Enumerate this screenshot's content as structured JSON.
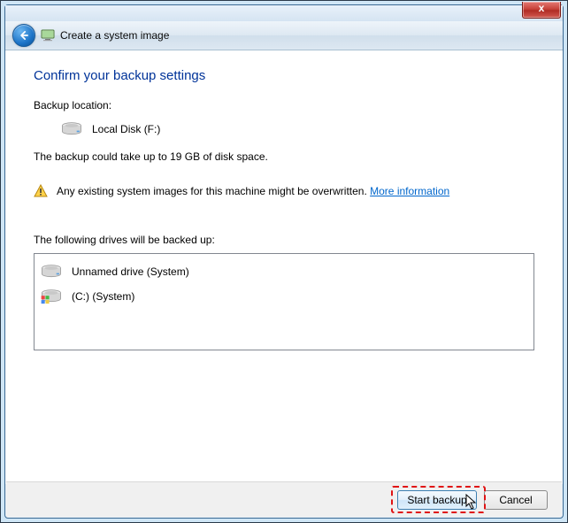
{
  "window": {
    "title": "Create a system image",
    "close_label": "x"
  },
  "content": {
    "heading": "Confirm your backup settings",
    "backup_location_label": "Backup location:",
    "backup_disk_name": "Local Disk (F:)",
    "size_estimate": "The backup could take up to 19 GB of disk space.",
    "warning_text": "Any existing system images for this machine might be overwritten. ",
    "more_info_label": "More information",
    "drives_label": "The following drives will be backed up:",
    "drives": [
      {
        "name": "Unnamed drive (System)"
      },
      {
        "name": "(C:) (System)"
      }
    ]
  },
  "footer": {
    "start_label": "Start backup",
    "cancel_label": "Cancel"
  }
}
